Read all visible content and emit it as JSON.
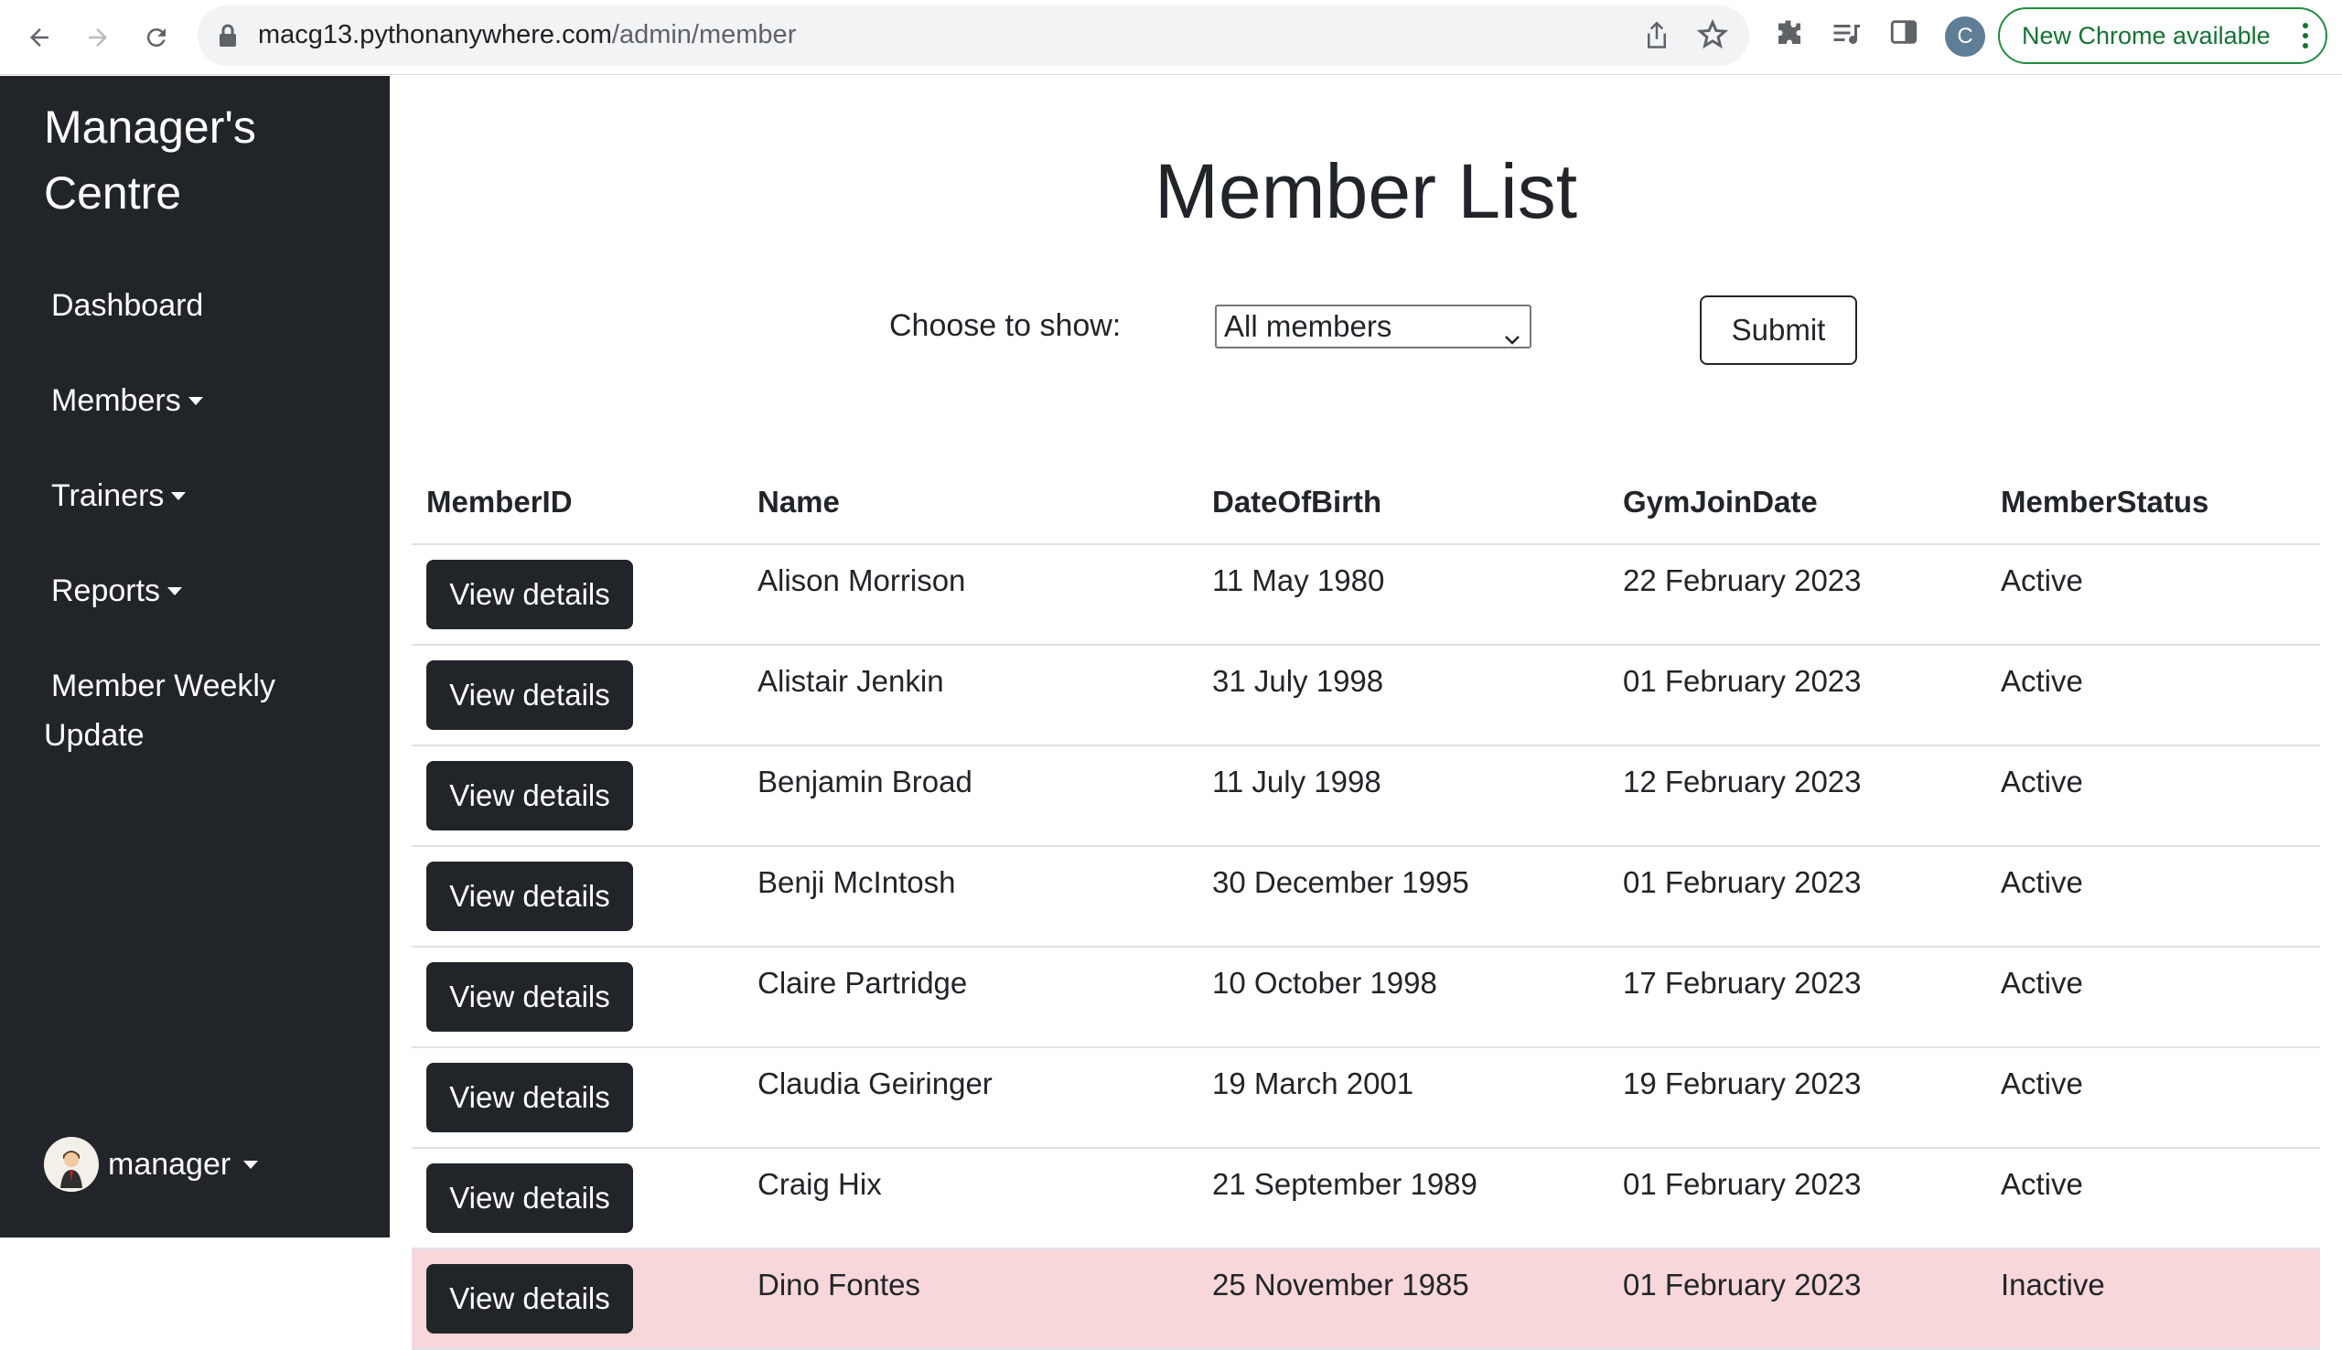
{
  "browser": {
    "url_host": "macg13.pythonanywhere.com",
    "url_path": "/admin/member",
    "profile_initial": "C",
    "update_badge": "New Chrome available"
  },
  "sidebar": {
    "brand": "Manager's Centre",
    "items": [
      {
        "label": "Dashboard"
      },
      {
        "label": "Members"
      },
      {
        "label": "Trainers"
      },
      {
        "label": "Reports"
      }
    ],
    "weekly": "Member Weekly Update",
    "user": "manager"
  },
  "main": {
    "title": "Member List",
    "filter": {
      "label": "Choose to show:",
      "selected": "All members",
      "submit": "Submit"
    },
    "table": {
      "headers": [
        "MemberID",
        "Name",
        "DateOfBirth",
        "GymJoinDate",
        "MemberStatus"
      ],
      "button_label": "View details",
      "rows": [
        {
          "name": "Alison Morrison",
          "dob": "11 May 1980",
          "join": "22 February 2023",
          "status": "Active"
        },
        {
          "name": "Alistair Jenkin",
          "dob": "31 July 1998",
          "join": "01 February 2023",
          "status": "Active"
        },
        {
          "name": "Benjamin Broad",
          "dob": "11 July 1998",
          "join": "12 February 2023",
          "status": "Active"
        },
        {
          "name": "Benji McIntosh",
          "dob": "30 December 1995",
          "join": "01 February 2023",
          "status": "Active"
        },
        {
          "name": "Claire Partridge",
          "dob": "10 October 1998",
          "join": "17 February 2023",
          "status": "Active"
        },
        {
          "name": "Claudia Geiringer",
          "dob": "19 March 2001",
          "join": "19 February 2023",
          "status": "Active"
        },
        {
          "name": "Craig Hix",
          "dob": "21 September 1989",
          "join": "01 February 2023",
          "status": "Active"
        },
        {
          "name": "Dino Fontes",
          "dob": "25 November 1985",
          "join": "01 February 2023",
          "status": "Inactive"
        }
      ]
    }
  },
  "colors": {
    "sidebar_bg": "#212529",
    "inactive_row": "#f8d7da",
    "update_green": "#137333"
  }
}
